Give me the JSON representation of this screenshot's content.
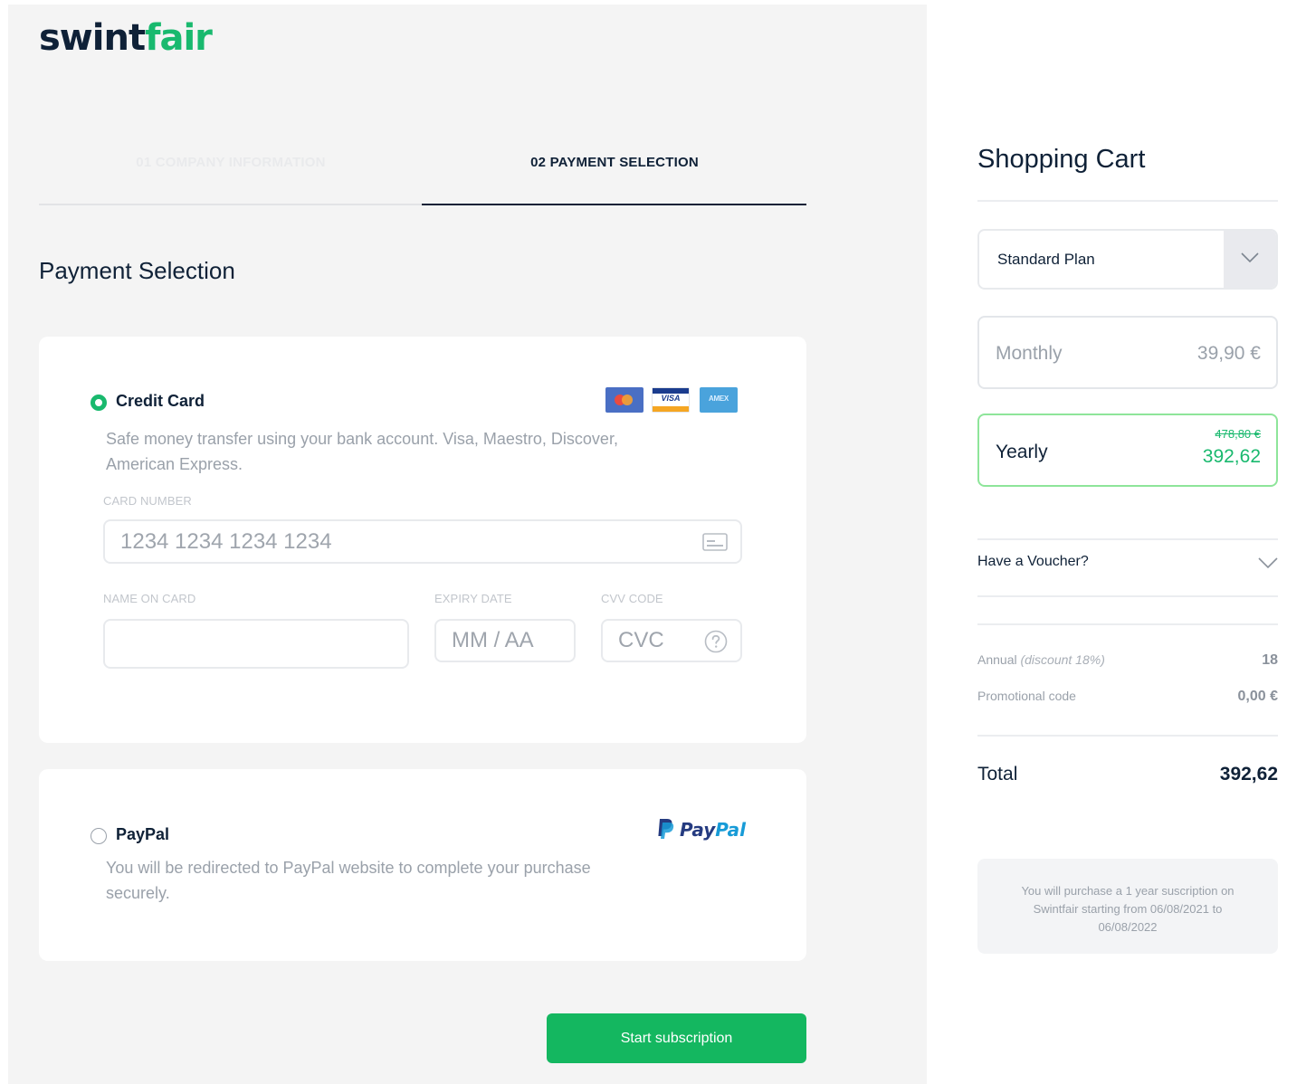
{
  "brand": {
    "logo_left": "swint",
    "logo_right": "fair"
  },
  "steps": [
    {
      "label": "01 COMPANY INFORMATION",
      "active": false
    },
    {
      "label": "02 PAYMENT SELECTION",
      "active": true
    }
  ],
  "payment": {
    "title": "Payment Selection",
    "credit_card": {
      "title": "Credit Card",
      "selected": true,
      "description": "Safe money transfer using your bank account. Visa, Maestro, Discover, American Express.",
      "icons": [
        "mastercard-icon",
        "visa-icon",
        "amex-icon"
      ],
      "visa_text": "VISA",
      "amex_text": "AMEX",
      "card_number_label": "CARD NUMBER",
      "card_number_placeholder": "1234 1234 1234 1234",
      "name_label": "NAME ON CARD",
      "name_placeholder": "",
      "expiry_label": "EXPIRY DATE",
      "expiry_placeholder": "MM / AA",
      "cvv_label": "CVV CODE",
      "cvv_placeholder": "CVC"
    },
    "paypal": {
      "title": "PayPal",
      "selected": false,
      "description": "You will be redirected to PayPal website to complete your purchase securely.",
      "logo_left": "Pay",
      "logo_right": "Pal"
    },
    "submit_label": "Start subscription"
  },
  "cart": {
    "title": "Shopping Cart",
    "plan": "Standard Plan",
    "monthly": {
      "label": "Monthly",
      "price": "39,90 €"
    },
    "yearly": {
      "label": "Yearly",
      "old_price": "478,80 €",
      "price": "392,62"
    },
    "voucher_label": "Have a Voucher?",
    "annual_label": "Annual",
    "annual_discount": "(discount 18%)",
    "annual_value": "18",
    "promo_label": "Promotional code",
    "promo_value": "0,00 €",
    "total_label": "Total",
    "total_value": "392,62",
    "notice": "You will purchase a 1 year suscription on Swintfair starting from 06/08/2021 to 06/08/2022"
  },
  "colors": {
    "brand_green": "#19b96e",
    "navy": "#0f2137",
    "button_green": "#14b760",
    "yearly_border": "#8ee59a"
  }
}
